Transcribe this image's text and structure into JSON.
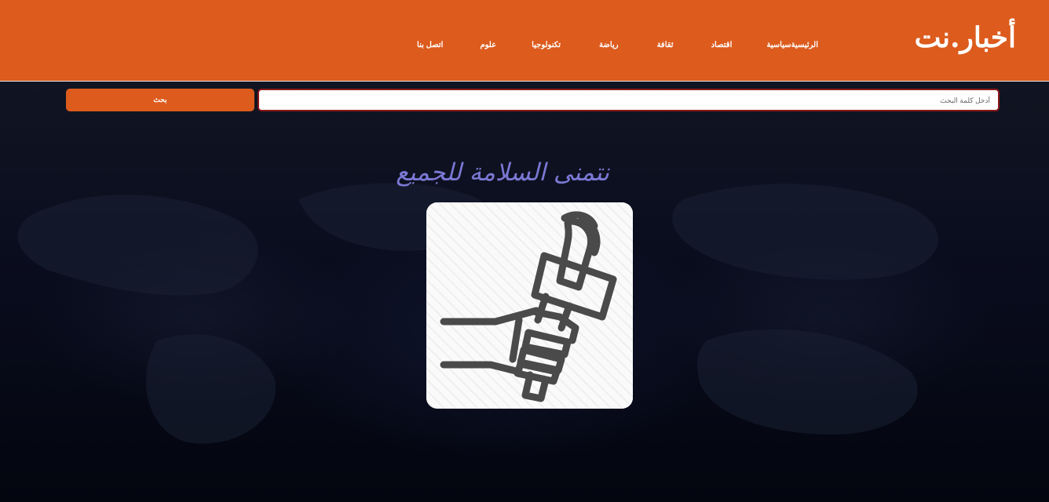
{
  "header": {
    "logo_text": "أخبار.نت",
    "nav_items": [
      {
        "label": "الرئيسية"
      },
      {
        "label": "سياسية"
      },
      {
        "label": "اقتصاد"
      },
      {
        "label": "ثقافة"
      },
      {
        "label": "رياضة"
      },
      {
        "label": "تكنولوجيا"
      },
      {
        "label": "علوم"
      },
      {
        "label": "اتصل بنا"
      }
    ],
    "colors": {
      "brand": "#dc5b1d"
    }
  },
  "search": {
    "placeholder": "أدخل كلمة البحث",
    "value": "",
    "button_label": "بحث"
  },
  "main": {
    "greeting": "نتمنى السلامة للجميع",
    "greeting_color": "#7b78d4",
    "card_icon": "microphone-in-hand-icon"
  }
}
